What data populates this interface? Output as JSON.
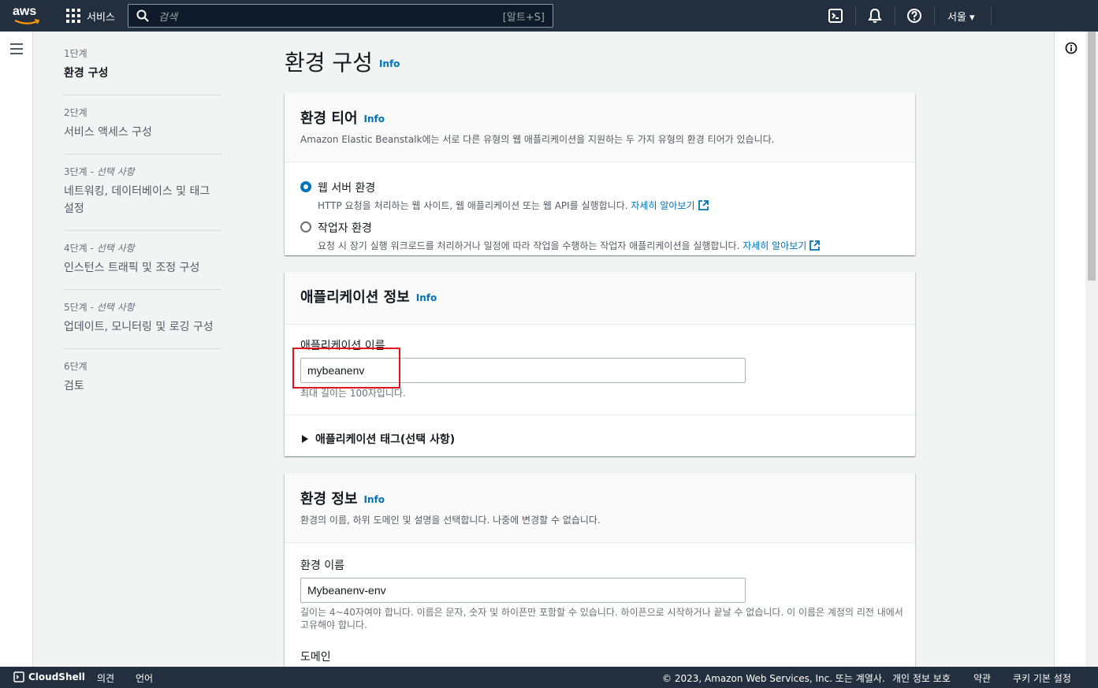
{
  "topnav": {
    "logo_text": "aws",
    "services_label": "서비스",
    "search_placeholder": "검색",
    "search_shortcut": "[알트+S]",
    "region_label": "서울 ▾",
    "icons": [
      "cloudshell-icon",
      "notifications-bell-icon",
      "help-icon"
    ]
  },
  "steps": [
    {
      "num": "1단계",
      "optional": "",
      "title": "환경 구성",
      "active": true
    },
    {
      "num": "2단계",
      "optional": "",
      "title": "서비스 액세스 구성"
    },
    {
      "num": "3단계 - ",
      "optional": "선택 사항",
      "title": "네트워킹, 데이터베이스 및 태그 설정"
    },
    {
      "num": "4단계 - ",
      "optional": "선택 사항",
      "title": "인스턴스 트래픽 및 조정 구성"
    },
    {
      "num": "5단계 - ",
      "optional": "선택 사항",
      "title": "업데이트, 모니터링 및 로깅 구성"
    },
    {
      "num": "6단계",
      "optional": "",
      "title": "검토"
    }
  ],
  "main": {
    "page_title": "환경 구성",
    "info_label": "Info",
    "env_tier": {
      "title": "환경 티어",
      "description": "Amazon Elastic Beanstalk에는 서로 다른 유형의 웹 애플리케이션을 지원하는 두 가지 유형의 환경 티어가 있습니다.",
      "options": [
        {
          "label": "웹 서버 환경",
          "desc": "HTTP 요청을 처리하는 웹 사이트, 웹 애플리케이션 또는 웹 API를 실행합니다.",
          "link": "자세히 알아보기",
          "checked": true
        },
        {
          "label": "작업자 환경",
          "desc": "요청 시 장기 실행 워크로드를 처리하거나 일정에 따라 작업을 수행하는 작업자 애플리케이션을 실행합니다.",
          "link": "자세히 알아보기",
          "checked": false
        }
      ]
    },
    "app_info": {
      "title": "애플리케이션 정보",
      "name_label": "애플리케이션 이름",
      "name_value": "mybeanenv",
      "name_hint": "최대 길이는 100자입니다.",
      "tags_label": "애플리케이션 태그(선택 사항)"
    },
    "env_info": {
      "title": "환경 정보",
      "description": "환경의 이름, 하위 도메인 및 설명을 선택합니다. 나중에 변경할 수 없습니다.",
      "name_label": "환경 이름",
      "name_value": "Mybeanenv-env",
      "name_hint": "길이는 4~40자여야 합니다. 이름은 문자, 숫자 및 하이픈만 포함할 수 있습니다. 하이픈으로 시작하거나 끝날 수 없습니다. 이 이름은 계정의 리전 내에서 고유해야 합니다.",
      "domain_label": "도메인"
    }
  },
  "footer": {
    "cloudshell": "CloudShell",
    "feedback": "의견",
    "language": "언어",
    "copyright": "© 2023, Amazon Web Services, Inc. 또는 계열사.",
    "privacy": "개인 정보 보호",
    "terms": "약관",
    "cookies": "쿠키 기본 설정"
  },
  "colors": {
    "nav_bg": "#232f3e",
    "link": "#0073bb",
    "highlight": "#e0141e"
  }
}
